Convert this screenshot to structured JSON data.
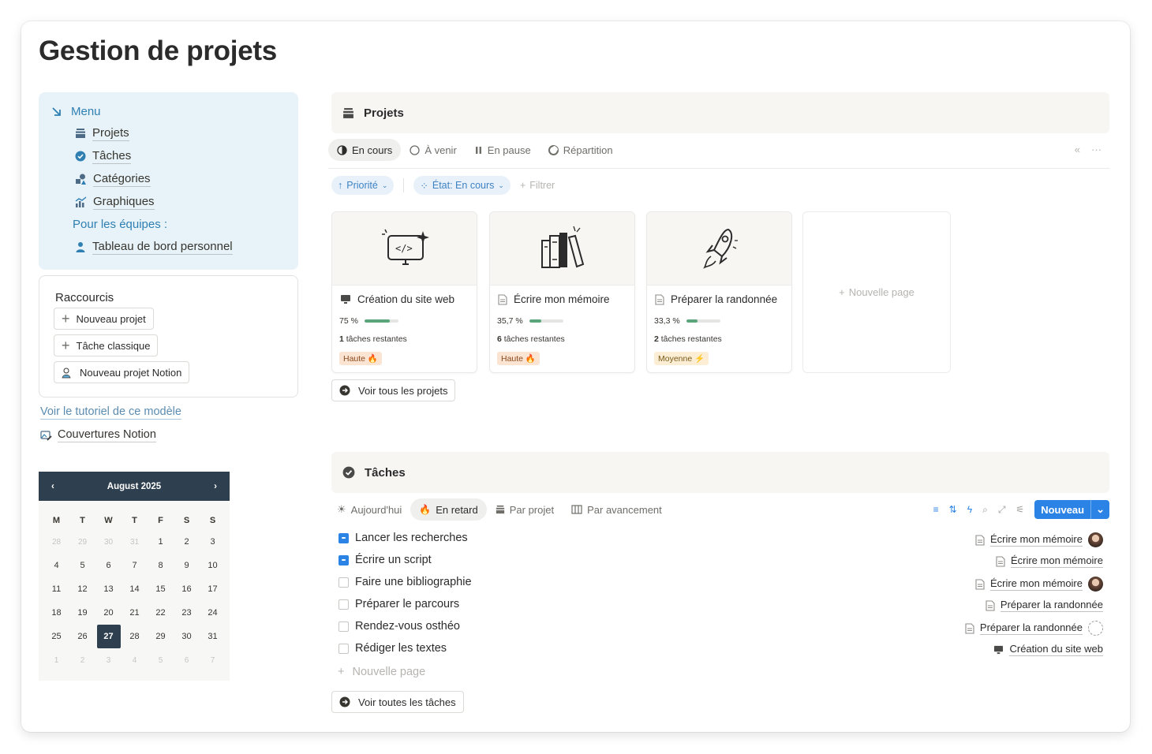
{
  "page": {
    "title": "Gestion de projets"
  },
  "menu": {
    "head": "Menu",
    "items": [
      {
        "label": "Projets",
        "icon": "stack-icon"
      },
      {
        "label": "Tâches",
        "icon": "check-circle-icon"
      },
      {
        "label": "Catégories",
        "icon": "shapes-icon"
      },
      {
        "label": "Graphiques",
        "icon": "chart-icon"
      }
    ],
    "subhead": "Pour les équipes :",
    "team_item": "Tableau de bord personnel"
  },
  "shortcuts": {
    "title": "Raccourcis",
    "buttons": [
      "Nouveau projet",
      "Tâche classique",
      "Nouveau projet Notion"
    ]
  },
  "links": {
    "tutorial": "Voir le tutoriel de ce modèle",
    "covers": "Couvertures Notion"
  },
  "calendar": {
    "month": "August 2025",
    "weekdays": [
      "M",
      "T",
      "W",
      "T",
      "F",
      "S",
      "S"
    ],
    "today": 27
  },
  "projects": {
    "title": "Projets",
    "tabs": [
      "En cours",
      "À venir",
      "En pause",
      "Répartition"
    ],
    "filters": {
      "priority": "Priorité",
      "state": "État: En cours",
      "add": "Filtrer"
    },
    "cards": [
      {
        "title": "Création du site web",
        "percent_label": "75 %",
        "progress": 0.75,
        "tasks_count": "1",
        "tasks_text": "tâches restantes",
        "badge": "Haute 🔥"
      },
      {
        "title": "Écrire mon mémoire",
        "percent_label": "35,7 %",
        "progress": 0.357,
        "tasks_count": "6",
        "tasks_text": "tâches restantes",
        "badge": "Haute 🔥"
      },
      {
        "title": "Préparer la randonnée",
        "percent_label": "33,3 %",
        "progress": 0.333,
        "tasks_count": "2",
        "tasks_text": "tâches restantes",
        "badge": "Moyenne ⚡"
      }
    ],
    "new_page": "Nouvelle page",
    "view_all": "Voir tous les projets"
  },
  "tasks": {
    "title": "Tâches",
    "tabs": [
      "Aujourd'hui",
      "En retard",
      "Par projet",
      "Par avancement"
    ],
    "new_button": "Nouveau",
    "rows": [
      {
        "name": "Lancer les recherches",
        "done": true,
        "project": "Écrire mon mémoire"
      },
      {
        "name": "Écrire un script",
        "done": true,
        "project": "Écrire mon mémoire"
      },
      {
        "name": "Faire une bibliographie",
        "done": false,
        "project": "Écrire mon mémoire"
      },
      {
        "name": "Préparer le parcours",
        "done": false,
        "project": "Préparer la randonnée"
      },
      {
        "name": "Rendez-vous osthéo",
        "done": false,
        "project": "Préparer la randonnée"
      },
      {
        "name": "Rédiger les textes",
        "done": false,
        "project": "Création du site web"
      }
    ],
    "new_page": "Nouvelle page",
    "view_all": "Voir toutes les tâches"
  },
  "colors": {
    "menu_bg": "#e7f3f8",
    "accent_blue": "#2b83e6",
    "calendar_header": "#2e3f4f",
    "progress_green": "#5aa67a",
    "badge_high_bg": "#fbe4d2",
    "badge_medium_bg": "#fbeed4"
  }
}
